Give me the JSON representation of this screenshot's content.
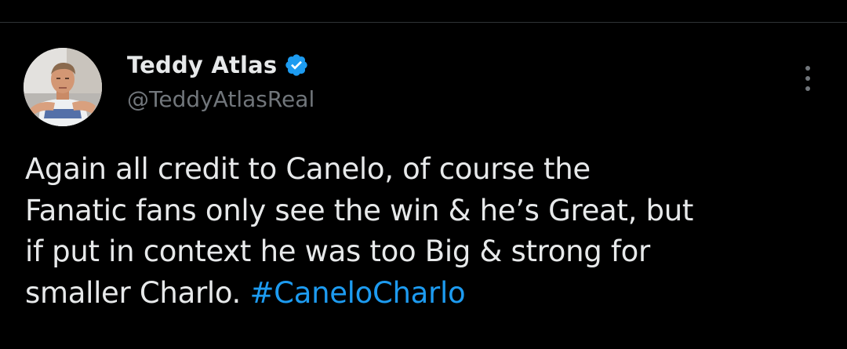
{
  "tweet": {
    "author": {
      "display_name": "Teddy Atlas",
      "handle": "@TeddyAtlasReal",
      "verified": true
    },
    "text_lines": "Again all credit to Canelo, of course the\nFanatic fans only see the win & he’s Great, but\nif put in context he was too Big & strong for\nsmaller Charlo. ",
    "hashtag": "#CaneloCharlo"
  },
  "colors": {
    "background": "#000000",
    "text": "#e7e9ea",
    "secondary_text": "#71767b",
    "accent": "#1d9bf0",
    "divider": "#2f3336"
  },
  "icons": {
    "verified": "verified-badge-icon",
    "more": "more-options-icon"
  }
}
